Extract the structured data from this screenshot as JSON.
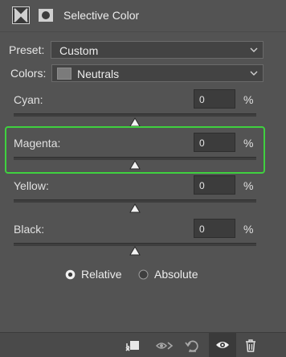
{
  "panel": {
    "title": "Selective Color"
  },
  "preset": {
    "label": "Preset:",
    "value": "Custom"
  },
  "colors": {
    "label": "Colors:",
    "value": "Neutrals"
  },
  "sliders": [
    {
      "label": "Cyan:",
      "value": "0",
      "unit": "%"
    },
    {
      "label": "Magenta:",
      "value": "0",
      "unit": "%"
    },
    {
      "label": "Yellow:",
      "value": "0",
      "unit": "%"
    },
    {
      "label": "Black:",
      "value": "0",
      "unit": "%"
    }
  ],
  "method": {
    "options": [
      "Relative",
      "Absolute"
    ],
    "selected": "Relative"
  },
  "accent_color": "#3fd13f",
  "footer_icons": [
    "clip-to-layer-icon",
    "view-previous-icon",
    "reset-icon",
    "visibility-eye-icon",
    "trash-icon"
  ]
}
